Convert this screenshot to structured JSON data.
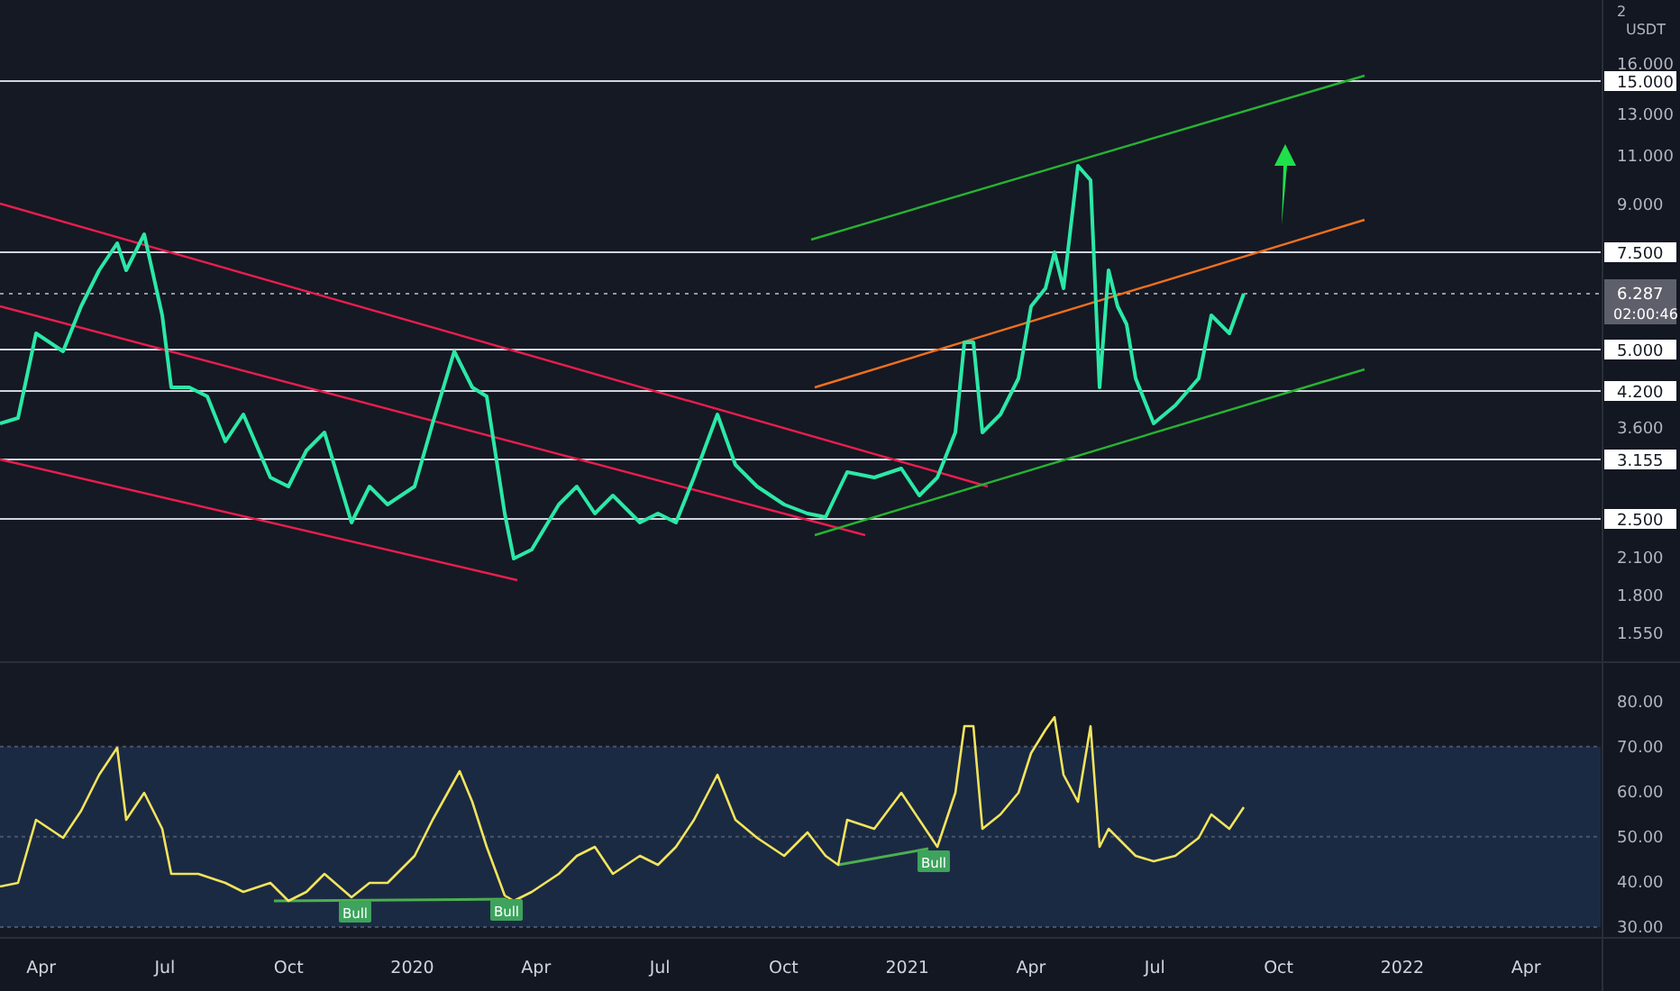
{
  "price_pane": {
    "cut_label": "2",
    "unit": "USDT",
    "axis_labels": [
      "16.000",
      "13.000",
      "11.000",
      "9.000",
      "3.600",
      "2.100",
      "1.800",
      "1.550"
    ],
    "level_tags": [
      "15.000",
      "7.500",
      "5.000",
      "4.200",
      "3.155",
      "2.500"
    ],
    "current_price": {
      "label": "6.287",
      "countdown": "02:00:46"
    }
  },
  "rsi_pane": {
    "axis_labels": [
      "80.00",
      "70.00",
      "60.00",
      "50.00",
      "40.00",
      "30.00"
    ],
    "signals": [
      "Bull",
      "Bull",
      "Bull"
    ]
  },
  "time_axis": {
    "labels": [
      "Apr",
      "Jul",
      "Oct",
      "2020",
      "Apr",
      "Jul",
      "Oct",
      "2021",
      "Apr",
      "Jul",
      "Oct",
      "2022",
      "Apr"
    ]
  }
}
